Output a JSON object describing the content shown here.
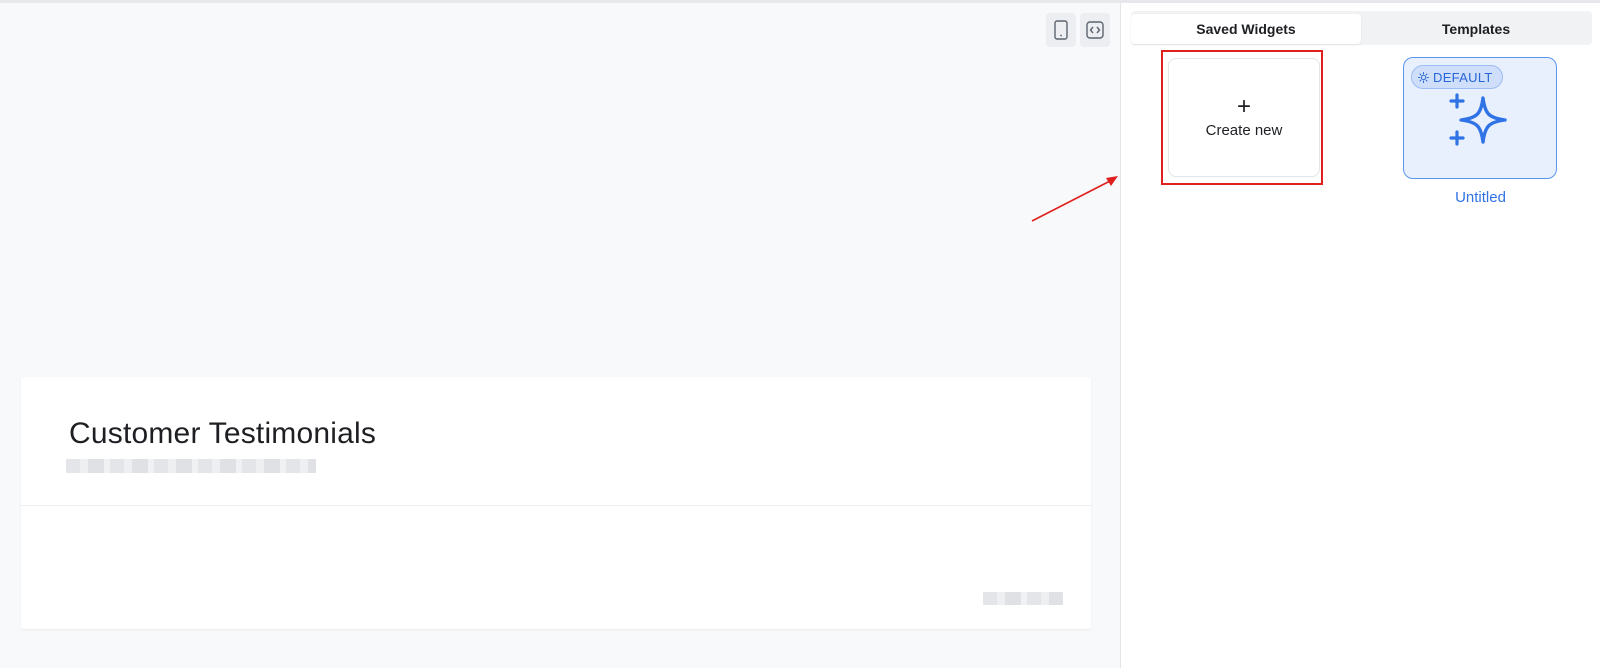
{
  "toolbar": {
    "mobile_icon": "mobile-device-icon",
    "embed_icon": "code-embed-icon"
  },
  "preview": {
    "title": "Customer Testimonials"
  },
  "panel": {
    "tabs": [
      {
        "label": "Saved Widgets",
        "active": true
      },
      {
        "label": "Templates",
        "active": false
      }
    ],
    "create_new": {
      "plus": "+",
      "label": "Create new"
    },
    "widgets": [
      {
        "badge": "DEFAULT",
        "badge_icon": "sun-icon",
        "thumbnail_icon": "sparkle-icon",
        "name": "Untitled"
      }
    ]
  },
  "colors": {
    "accent": "#2f73e6",
    "highlight": "#e0201c",
    "widget_bg": "#e9f0fd"
  }
}
